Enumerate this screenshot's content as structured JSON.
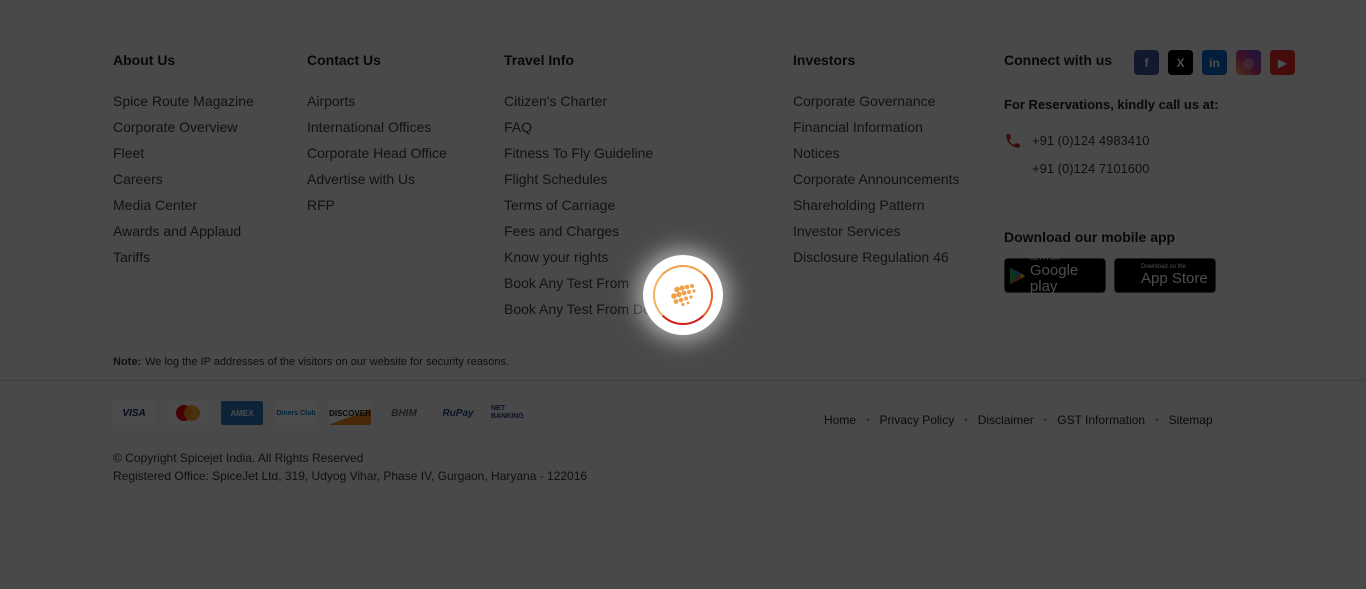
{
  "columns": {
    "about": {
      "heading": "About Us",
      "items": [
        "Spice Route Magazine",
        "Corporate Overview",
        "Fleet",
        "Careers",
        "Media Center",
        "Awards and Applaud",
        "Tariffs"
      ]
    },
    "contact": {
      "heading": "Contact Us",
      "items": [
        "Airports",
        "International Offices",
        "Corporate Head Office",
        "Advertise with Us",
        "RFP"
      ]
    },
    "travel": {
      "heading": "Travel Info",
      "items": [
        "Citizen's Charter",
        "FAQ",
        "Fitness To Fly Guideline",
        "Flight Schedules",
        "Terms of Carriage",
        "Fees and Charges",
        "Know your rights",
        "Book Any Test From",
        "Book Any Test From Delhi"
      ]
    },
    "investors": {
      "heading": "Investors",
      "items": [
        "Corporate Governance",
        "Financial Information",
        "Notices",
        "Corporate Announcements",
        "Shareholding Pattern",
        "Investor Services",
        "Disclosure Regulation 46"
      ]
    }
  },
  "connect": {
    "heading": "Connect with us",
    "social": [
      {
        "name": "facebook-icon",
        "glyph": "f",
        "color": "#3b5998"
      },
      {
        "name": "x-icon",
        "glyph": "X",
        "color": "#000000"
      },
      {
        "name": "linkedin-icon",
        "glyph": "in",
        "color": "#0a66c2"
      },
      {
        "name": "instagram-icon",
        "glyph": "◎",
        "color": "#c13584"
      },
      {
        "name": "youtube-icon",
        "glyph": "▶",
        "color": "#e52d27"
      }
    ],
    "reservations_label": "For Reservations, kindly call us at:",
    "phones": [
      "+91 (0)124 4983410",
      "+91 (0)124 7101600"
    ],
    "download_label": "Download our mobile app",
    "google_play": {
      "small": "GET IT ON",
      "big": "Google play"
    },
    "app_store": {
      "small": "Download on the",
      "big": "App Store"
    }
  },
  "note": {
    "label": "Note:",
    "text": "We log the IP addresses of the visitors on our website for security reasons."
  },
  "payments": [
    "VISA",
    "MasterCard",
    "AMEX",
    "Diners Club",
    "DISCOVER",
    "BHIM",
    "RuPay",
    "NET BANKING"
  ],
  "copyright": {
    "line1": "© Copyright Spicejet India. All Rights Reserved",
    "line2": "Registered Office: SpiceJet Ltd, 319, Udyog Vihar, Phase IV, Gurgaon, Haryana - 122016"
  },
  "bottom_links": [
    "Home",
    "Privacy Policy",
    "Disclaimer",
    "GST Information",
    "Sitemap"
  ],
  "colors": {
    "overlay": "rgba(0,0,0,0.70)",
    "brand_orange": "#f0a24a",
    "brand_red": "#d21f1f"
  }
}
